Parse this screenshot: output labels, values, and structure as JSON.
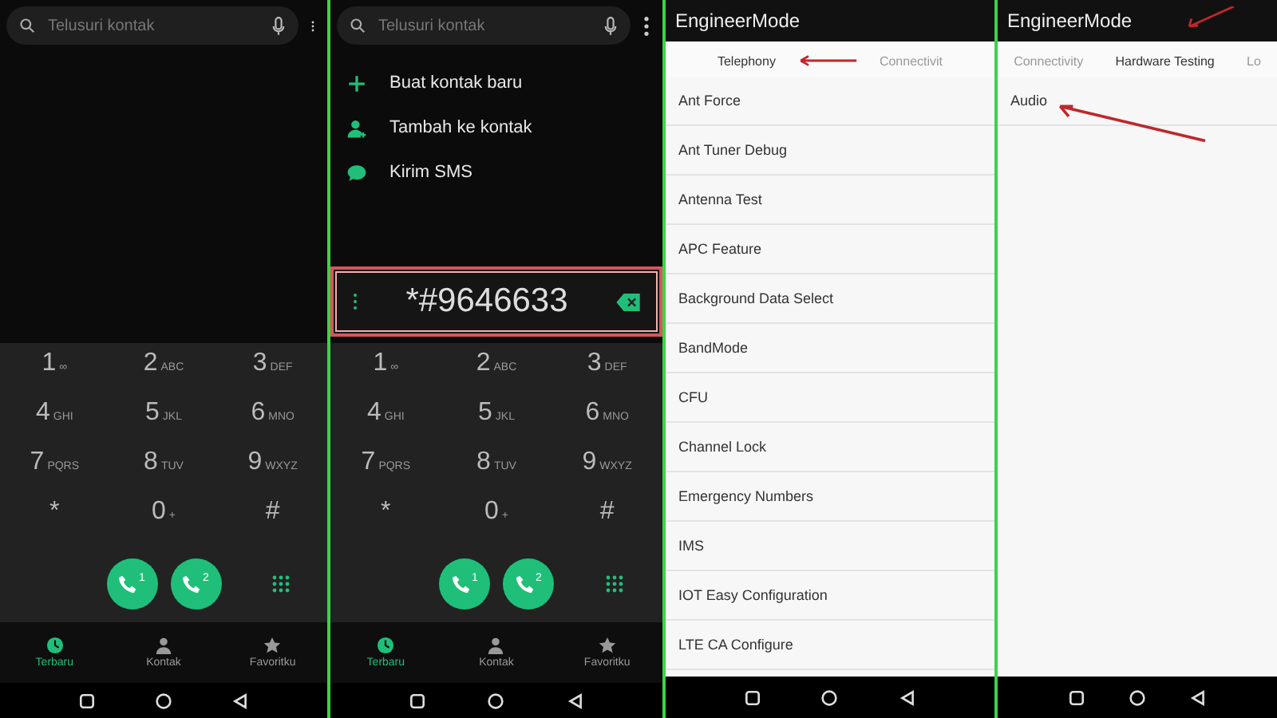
{
  "screens": [
    {
      "kind": "dialer",
      "search": {
        "placeholder": "Telusuri kontak"
      },
      "keypad": [
        {
          "digit": "1",
          "letters": "∞"
        },
        {
          "digit": "2",
          "letters": "ABC"
        },
        {
          "digit": "3",
          "letters": "DEF"
        },
        {
          "digit": "4",
          "letters": "GHI"
        },
        {
          "digit": "5",
          "letters": "JKL"
        },
        {
          "digit": "6",
          "letters": "MNO"
        },
        {
          "digit": "7",
          "letters": "PQRS"
        },
        {
          "digit": "8",
          "letters": "TUV"
        },
        {
          "digit": "9",
          "letters": "WXYZ"
        },
        {
          "digit": "*"
        },
        {
          "digit": "0",
          "letters": "+"
        },
        {
          "digit": "#"
        }
      ],
      "call_buttons": [
        {
          "sim": "1"
        },
        {
          "sim": "2"
        }
      ],
      "nav_tabs": [
        {
          "label": "Terbaru",
          "selected": true
        },
        {
          "label": "Kontak",
          "selected": false
        },
        {
          "label": "Favoritku",
          "selected": false
        }
      ]
    },
    {
      "kind": "dialer",
      "search": {
        "placeholder": "Telusuri kontak"
      },
      "suggestions": [
        {
          "kind": "add",
          "label": "Buat kontak baru"
        },
        {
          "kind": "person",
          "label": "Tambah ke kontak"
        },
        {
          "kind": "sms",
          "label": "Kirim SMS"
        }
      ],
      "dialed": {
        "value": "*#9646633",
        "highlighted": true
      },
      "keypad": [
        {
          "digit": "1",
          "letters": "∞"
        },
        {
          "digit": "2",
          "letters": "ABC"
        },
        {
          "digit": "3",
          "letters": "DEF"
        },
        {
          "digit": "4",
          "letters": "GHI"
        },
        {
          "digit": "5",
          "letters": "JKL"
        },
        {
          "digit": "6",
          "letters": "MNO"
        },
        {
          "digit": "7",
          "letters": "PQRS"
        },
        {
          "digit": "8",
          "letters": "TUV"
        },
        {
          "digit": "9",
          "letters": "WXYZ"
        },
        {
          "digit": "*"
        },
        {
          "digit": "0",
          "letters": "+"
        },
        {
          "digit": "#"
        }
      ],
      "call_buttons": [
        {
          "sim": "1"
        },
        {
          "sim": "2"
        }
      ],
      "nav_tabs": [
        {
          "label": "Terbaru",
          "selected": true
        },
        {
          "label": "Kontak",
          "selected": false
        },
        {
          "label": "Favoritku",
          "selected": false
        }
      ]
    },
    {
      "kind": "engineer",
      "title": "EngineerMode",
      "tabs": [
        {
          "label": "Telephony",
          "selected": true,
          "arrow": true
        },
        {
          "label": "Connectivit",
          "selected": false,
          "arrow": false
        }
      ],
      "items": [
        {
          "label": "Ant Force",
          "arrow": false
        },
        {
          "label": "Ant Tuner Debug",
          "arrow": false
        },
        {
          "label": "Antenna Test",
          "arrow": false
        },
        {
          "label": "APC Feature",
          "arrow": false
        },
        {
          "label": "Background Data Select",
          "arrow": false
        },
        {
          "label": "BandMode",
          "arrow": false
        },
        {
          "label": "CFU",
          "arrow": false
        },
        {
          "label": "Channel Lock",
          "arrow": false
        },
        {
          "label": "Emergency Numbers",
          "arrow": false
        },
        {
          "label": "IMS",
          "arrow": false
        },
        {
          "label": "IOT Easy Configuration",
          "arrow": false
        },
        {
          "label": "LTE CA Configure",
          "arrow": false
        }
      ]
    },
    {
      "kind": "engineer",
      "title": "EngineerMode",
      "tabs": [
        {
          "label": "Connectivity",
          "selected": false,
          "arrow": false
        },
        {
          "label": "Hardware Testing",
          "selected": true,
          "arrow": true
        },
        {
          "label": "Lo",
          "selected": false,
          "arrow": false
        }
      ],
      "items": [
        {
          "label": "Audio",
          "arrow": true
        }
      ]
    }
  ]
}
